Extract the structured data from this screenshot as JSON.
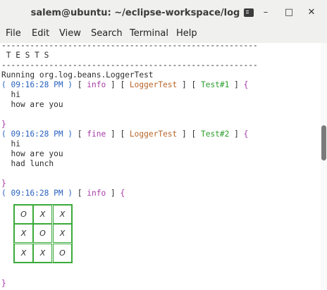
{
  "window": {
    "title": "salem@ubuntu: ~/eclipse-workspace/log",
    "minimize": "–",
    "maximize": "□",
    "close": "✕"
  },
  "menu": [
    "File",
    "Edit",
    "View",
    "Search",
    "Terminal",
    "Help"
  ],
  "terminal": {
    "sep1": "------------------------------------------------------",
    "tests_header": " T E S T S",
    "sep2": "------------------------------------------------------",
    "running": "Running org.log.beans.LoggerTest",
    "block1": {
      "time": "( 09:16:28 PM )",
      "level": "info",
      "class": "LoggerTest",
      "test": "Test#1",
      "lines": [
        "  hi",
        "  how are you"
      ]
    },
    "block2": {
      "time": "( 09:16:28 PM )",
      "level": "fine",
      "class": "LoggerTest",
      "test": "Test#2",
      "lines": [
        "  hi",
        "  how are you",
        "  had lunch"
      ]
    },
    "block3": {
      "time": "( 09:16:28 PM )",
      "level": "info",
      "board": [
        [
          "O",
          "X",
          "X"
        ],
        [
          "X",
          "O",
          "X"
        ],
        [
          "X",
          "X",
          "O"
        ]
      ]
    },
    "open_brace": "{",
    "close_brace": "}"
  }
}
